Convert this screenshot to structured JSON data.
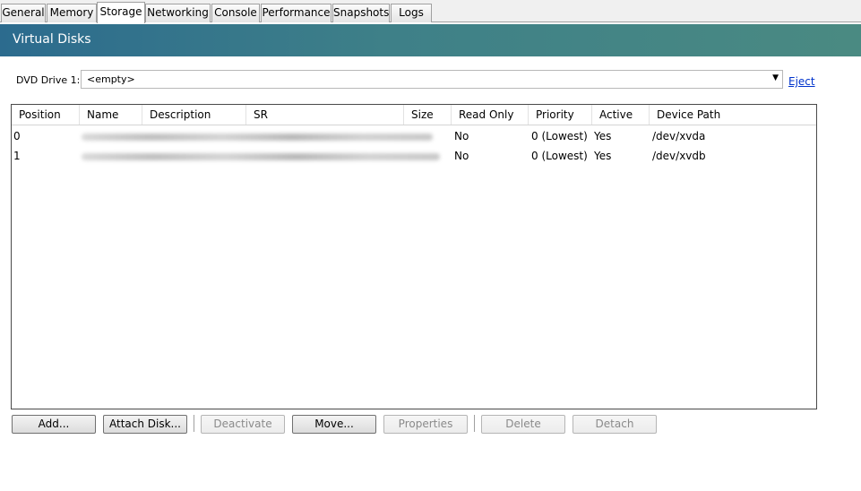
{
  "tabs": [
    "General",
    "Memory",
    "Storage",
    "Networking",
    "Console",
    "Performance",
    "Snapshots",
    "Logs"
  ],
  "active_tab": "Storage",
  "header": {
    "title": "Virtual Disks"
  },
  "dvd": {
    "label": "DVD Drive 1:",
    "value": "<empty>",
    "eject_label": "Eject"
  },
  "grid": {
    "columns": [
      "Position",
      "Name",
      "Description",
      "SR",
      "Size",
      "Read Only",
      "Priority",
      "Active",
      "Device Path"
    ],
    "rows": [
      {
        "position": "0",
        "read_only": "No",
        "priority": "0 (Lowest)",
        "active": "Yes",
        "device_path": "/dev/xvda"
      },
      {
        "position": "1",
        "read_only": "No",
        "priority": "0 (Lowest)",
        "active": "Yes",
        "device_path": "/dev/xvdb"
      }
    ]
  },
  "buttons": {
    "add": "Add...",
    "attach": "Attach Disk...",
    "deactivate": "Deactivate",
    "move": "Move...",
    "properties": "Properties",
    "delete": "Delete",
    "detach": "Detach"
  }
}
